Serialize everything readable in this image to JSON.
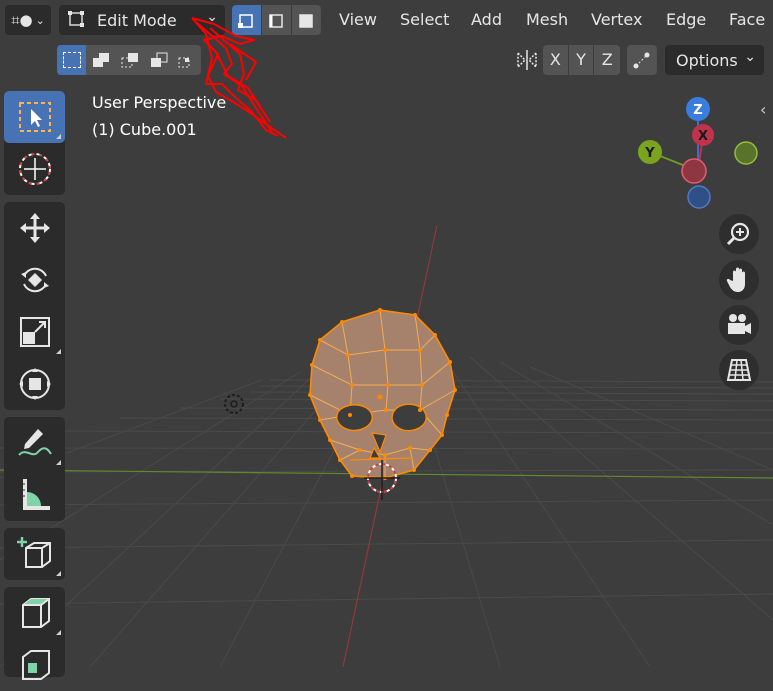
{
  "header": {
    "mode_label": "Edit Mode",
    "menus": [
      "View",
      "Select",
      "Add",
      "Mesh",
      "Vertex",
      "Edge",
      "Face"
    ],
    "axis_x": "X",
    "axis_y": "Y",
    "axis_z": "Z",
    "options_label": "Options"
  },
  "overlay": {
    "view_name": "User Perspective",
    "object_name": "(1) Cube.001"
  },
  "gizmo": {
    "z_label": "Z",
    "x_label": "X",
    "y_label": "Y"
  },
  "colors": {
    "accent": "#4772b3",
    "selection": "#ff8a00",
    "annotation": "#ff0000"
  },
  "icons": [
    "editor-type-icon",
    "mesh-mode-icon",
    "vertex-select-icon",
    "edge-select-icon",
    "face-select-icon",
    "mirror-icon",
    "proportional-icon",
    "select-box-icon",
    "cursor-icon",
    "move-icon",
    "rotate-icon",
    "scale-icon",
    "transform-icon",
    "annotate-icon",
    "measure-icon",
    "add-cube-icon",
    "extrude-icon",
    "inset-icon",
    "zoom-icon",
    "hand-icon",
    "camera-icon",
    "grid-icon"
  ]
}
